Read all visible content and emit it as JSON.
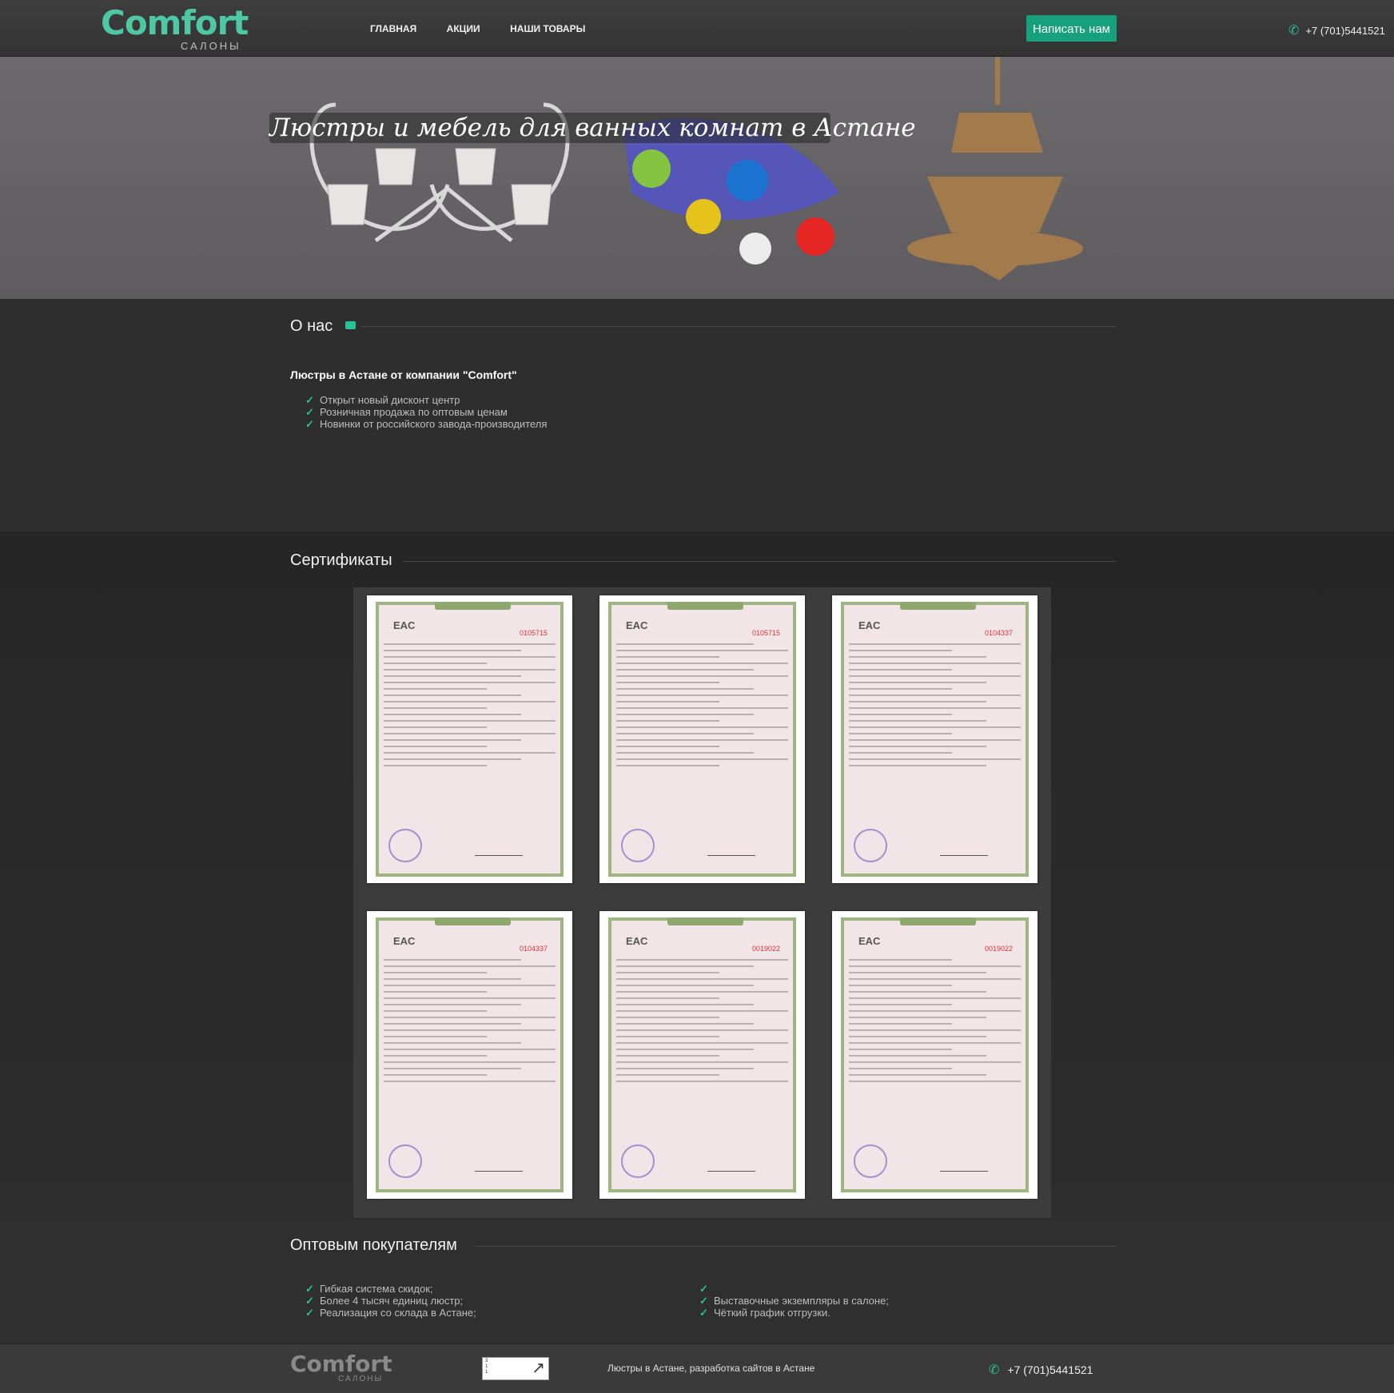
{
  "header": {
    "logo_word": "Comfort",
    "logo_sub": "САЛОНЫ",
    "nav": [
      "ГЛАВНАЯ",
      "АКЦИИ",
      "НАШИ ТОВАРЫ"
    ],
    "write_button": "Написать нам",
    "phone": "+7 (701)5441521",
    "phone_icon": "phone-icon",
    "accent_color": "#16a07c"
  },
  "hero": {
    "title": "Люстры и мебель для ванных комнат в Астане"
  },
  "about": {
    "title": "О нас",
    "subtitle": "Люстры в Астане от компании \"Comfort\"",
    "items": [
      "Открыт новый дисконт центр",
      "Розничная продажа по оптовым ценам",
      "Новинки от российского завода-производителя"
    ]
  },
  "certificates": {
    "title": "Сертификаты",
    "numbers": [
      "0105715",
      "0105715",
      "0104337",
      "0104337",
      "0019022",
      "0019022"
    ]
  },
  "wholesale": {
    "title": "Оптовым покупателям",
    "left": [
      "Гибкая система скидок;",
      "Более 4 тысяч единиц люстр;",
      "Реализация со склада в Астане;"
    ],
    "right": [
      "",
      "Выставочные экземпляры в салоне;",
      "Чёткий график отгрузки."
    ]
  },
  "footer": {
    "logo_word": "Comfort",
    "logo_sub": "САЛОНЫ",
    "counter": [
      "3",
      "1",
      "1"
    ],
    "text": "Люстры в Астане, разработка сайтов в Астане",
    "phone": "+7 (701)5441521"
  }
}
